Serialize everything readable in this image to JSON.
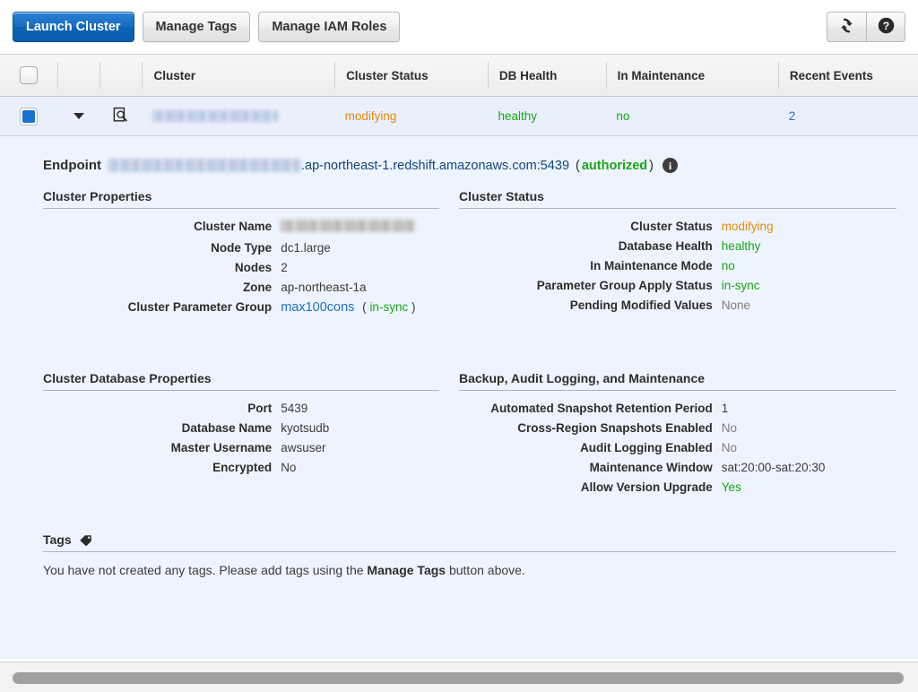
{
  "toolbar": {
    "launch_cluster": "Launch Cluster",
    "manage_tags": "Manage Tags",
    "manage_iam_roles": "Manage IAM Roles",
    "refresh_icon": "refresh-icon",
    "help_icon": "help-icon"
  },
  "table": {
    "columns": [
      "",
      "",
      "",
      "Cluster",
      "Cluster Status",
      "DB Health",
      "In Maintenance",
      "Recent Events"
    ],
    "row": {
      "selected": true,
      "cluster_name": "",
      "cluster_status": "modifying",
      "db_health": "healthy",
      "in_maintenance": "no",
      "recent_events": "2"
    }
  },
  "detail": {
    "endpoint_label": "Endpoint",
    "endpoint_host_suffix": ".ap-northeast-1.redshift.amazonaws.com:5439",
    "endpoint_paren_open": "(",
    "endpoint_authorized": "authorized",
    "endpoint_paren_close": ")",
    "info_icon": "info-icon",
    "cluster_properties": {
      "title": "Cluster Properties",
      "rows": [
        {
          "label": "Cluster Name",
          "value": "",
          "redacted": true
        },
        {
          "label": "Node Type",
          "value": "dc1.large"
        },
        {
          "label": "Nodes",
          "value": "2"
        },
        {
          "label": "Zone",
          "value": "ap-northeast-1a"
        },
        {
          "label": "Cluster Parameter Group",
          "value": "max100cons",
          "link": true,
          "suffix_open": "(",
          "suffix": "in-sync",
          "suffix_close": ")"
        }
      ]
    },
    "cluster_status": {
      "title": "Cluster Status",
      "rows": [
        {
          "label": "Cluster Status",
          "value": "modifying",
          "color": "orange"
        },
        {
          "label": "Database Health",
          "value": "healthy",
          "color": "green"
        },
        {
          "label": "In Maintenance Mode",
          "value": "no",
          "color": "green"
        },
        {
          "label": "Parameter Group Apply Status",
          "value": "in-sync",
          "color": "green"
        },
        {
          "label": "Pending Modified Values",
          "value": "None",
          "color": "grey"
        }
      ]
    },
    "database_properties": {
      "title": "Cluster Database Properties",
      "rows": [
        {
          "label": "Port",
          "value": "5439"
        },
        {
          "label": "Database Name",
          "value": "kyotsudb"
        },
        {
          "label": "Master Username",
          "value": "awsuser"
        },
        {
          "label": "Encrypted",
          "value": "No"
        }
      ]
    },
    "backup_maintenance": {
      "title": "Backup, Audit Logging, and Maintenance",
      "rows": [
        {
          "label": "Automated Snapshot Retention Period",
          "value": "1"
        },
        {
          "label": "Cross-Region Snapshots Enabled",
          "value": "No",
          "color": "grey"
        },
        {
          "label": "Audit Logging Enabled",
          "value": "No",
          "color": "grey"
        },
        {
          "label": "Maintenance Window",
          "value": "sat:20:00-sat:20:30"
        },
        {
          "label": "Allow Version Upgrade",
          "value": "Yes",
          "color": "green"
        }
      ]
    },
    "tags": {
      "title": "Tags",
      "icon": "tag-icon",
      "message_before": "You have not created any tags. Please add tags using the ",
      "message_bold": "Manage Tags",
      "message_after": " button above."
    }
  },
  "colors": {
    "primary_button": "#0d63b8",
    "link": "#1f6fc4",
    "status_ok": "#16a616",
    "status_warn": "#e8890c",
    "panel_bg": "#eef4fd",
    "row_selected_bg": "#e9effb"
  }
}
